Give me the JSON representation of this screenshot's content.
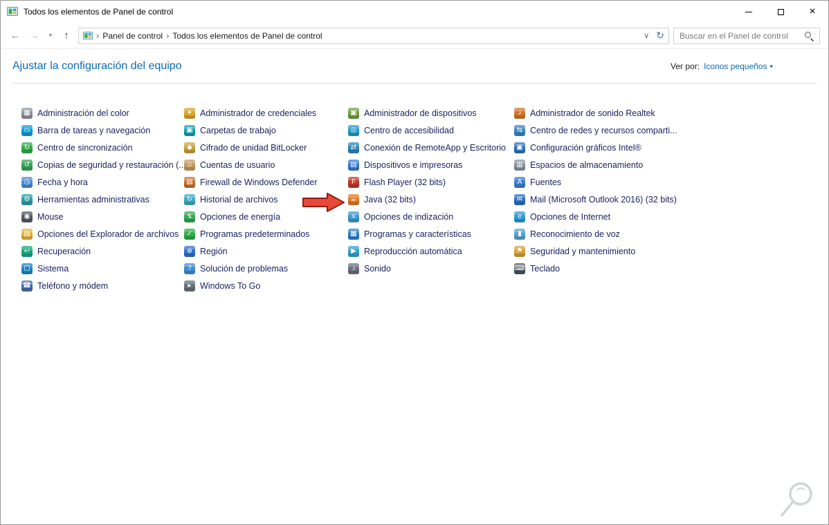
{
  "window": {
    "title": "Todos los elementos de Panel de control"
  },
  "toolbar": {
    "breadcrumb": {
      "segment1": "Panel de control",
      "segment2": "Todos los elementos de Panel de control"
    },
    "search_placeholder": "Buscar en el Panel de control"
  },
  "header": {
    "title": "Ajustar la configuración del equipo",
    "view_by_label": "Ver por:",
    "view_by_value": "Iconos pequeños"
  },
  "colors": {
    "accent": "#0a6bb8",
    "item_text": "#18205f",
    "arrow_fill": "#e8493a",
    "arrow_stroke": "#931c10"
  },
  "columns": [
    {
      "items": [
        {
          "label": "Administración del color",
          "icon": "color-management",
          "color": "#8e949e",
          "glyph": "▦"
        },
        {
          "label": "Barra de tareas y navegación",
          "icon": "taskbar-navigation",
          "color": "#159fd9",
          "glyph": "▭"
        },
        {
          "label": "Centro de sincronización",
          "icon": "sync-center",
          "color": "#2fae4a",
          "glyph": "↻"
        },
        {
          "label": "Copias de seguridad y restauración (...",
          "icon": "backup-restore",
          "color": "#37a457",
          "glyph": "↺"
        },
        {
          "label": "Fecha y hora",
          "icon": "date-time",
          "color": "#4a8fd4",
          "glyph": "◷"
        },
        {
          "label": "Herramientas administrativas",
          "icon": "admin-tools",
          "color": "#2e9ea6",
          "glyph": "⚙"
        },
        {
          "label": "Mouse",
          "icon": "mouse",
          "color": "#565b63",
          "glyph": "◉"
        },
        {
          "label": "Opciones del Explorador de archivos",
          "icon": "file-explorer-options",
          "color": "#e3b43a",
          "glyph": "▤"
        },
        {
          "label": "Recuperación",
          "icon": "recovery",
          "color": "#19a87f",
          "glyph": "↩"
        },
        {
          "label": "Sistema",
          "icon": "system",
          "color": "#1d87c6",
          "glyph": "▢"
        },
        {
          "label": "Teléfono y módem",
          "icon": "phone-modem",
          "color": "#4a6fae",
          "glyph": "☎"
        }
      ]
    },
    {
      "items": [
        {
          "label": "Administrador de credenciales",
          "icon": "credential-manager",
          "color": "#d9a62c",
          "glyph": "✦"
        },
        {
          "label": "Carpetas de trabajo",
          "icon": "work-folders",
          "color": "#14a0b0",
          "glyph": "▣"
        },
        {
          "label": "Cifrado de unidad BitLocker",
          "icon": "bitlocker",
          "color": "#c8a23f",
          "glyph": "◆"
        },
        {
          "label": "Cuentas de usuario",
          "icon": "user-accounts",
          "color": "#c59a63",
          "glyph": "☺"
        },
        {
          "label": "Firewall de Windows Defender",
          "icon": "windows-defender-firewall",
          "color": "#c7722f",
          "glyph": "▤"
        },
        {
          "label": "Historial de archivos",
          "icon": "file-history",
          "color": "#3fa9c9",
          "glyph": "↻"
        },
        {
          "label": "Opciones de energía",
          "icon": "power-options",
          "color": "#34a853",
          "glyph": "↯"
        },
        {
          "label": "Programas predeterminados",
          "icon": "default-programs",
          "color": "#2fae4a",
          "glyph": "✓"
        },
        {
          "label": "Región",
          "icon": "region",
          "color": "#2f6fce",
          "glyph": "⊕"
        },
        {
          "label": "Solución de problemas",
          "icon": "troubleshooting",
          "color": "#3f8fd1",
          "glyph": "?"
        },
        {
          "label": "Windows To Go",
          "icon": "windows-to-go",
          "color": "#6a717a",
          "glyph": "▸"
        }
      ]
    },
    {
      "items": [
        {
          "label": "Administrador de dispositivos",
          "icon": "device-manager",
          "color": "#6f9f3e",
          "glyph": "▣"
        },
        {
          "label": "Centro de accesibilidad",
          "icon": "ease-of-access-center",
          "color": "#1f9ccd",
          "glyph": "◎"
        },
        {
          "label": "Conexión de RemoteApp y Escritorio",
          "icon": "remoteapp-desktop",
          "color": "#2e86c1",
          "glyph": "⇄"
        },
        {
          "label": "Dispositivos e impresoras",
          "icon": "devices-printers",
          "color": "#3a7bd5",
          "glyph": "▤"
        },
        {
          "label": "Flash Player (32 bits)",
          "icon": "flash-player",
          "color": "#c0392b",
          "glyph": "F"
        },
        {
          "label": "Java (32 bits)",
          "icon": "java",
          "color": "#e07b2a",
          "glyph": "☕"
        },
        {
          "label": "Opciones de indización",
          "icon": "indexing-options",
          "color": "#3f9ad1",
          "glyph": "≡"
        },
        {
          "label": "Programas y características",
          "icon": "programs-features",
          "color": "#2d7dd2",
          "glyph": "▦"
        },
        {
          "label": "Reproducción automática",
          "icon": "autoplay",
          "color": "#35a0d0",
          "glyph": "▶"
        },
        {
          "label": "Sonido",
          "icon": "sound",
          "color": "#6b7280",
          "glyph": "♪"
        }
      ]
    },
    {
      "items": [
        {
          "label": "Administrador de sonido Realtek",
          "icon": "realtek-sound-manager",
          "color": "#d4752c",
          "glyph": "♪"
        },
        {
          "label": "Centro de redes y recursos comparti...",
          "icon": "network-sharing-center",
          "color": "#3b86c8",
          "glyph": "⇆"
        },
        {
          "label": "Configuración gráficos Intel®",
          "icon": "intel-graphics",
          "color": "#2a72c0",
          "glyph": "▣"
        },
        {
          "label": "Espacios de almacenamiento",
          "icon": "storage-spaces",
          "color": "#8a93a0",
          "glyph": "▥"
        },
        {
          "label": "Fuentes",
          "icon": "fonts",
          "color": "#3c7fd0",
          "glyph": "A"
        },
        {
          "label": "Mail (Microsoft Outlook 2016) (32 bits)",
          "icon": "mail",
          "color": "#2d6fc2",
          "glyph": "✉"
        },
        {
          "label": "Opciones de Internet",
          "icon": "internet-options",
          "color": "#2e9ad6",
          "glyph": "e"
        },
        {
          "label": "Reconocimiento de voz",
          "icon": "speech-recognition",
          "color": "#58a3d4",
          "glyph": "▮"
        },
        {
          "label": "Seguridad y mantenimiento",
          "icon": "security-maintenance",
          "color": "#d8a23a",
          "glyph": "⚑"
        },
        {
          "label": "Teclado",
          "icon": "keyboard",
          "color": "#4a5560",
          "glyph": "⌨"
        }
      ]
    }
  ]
}
